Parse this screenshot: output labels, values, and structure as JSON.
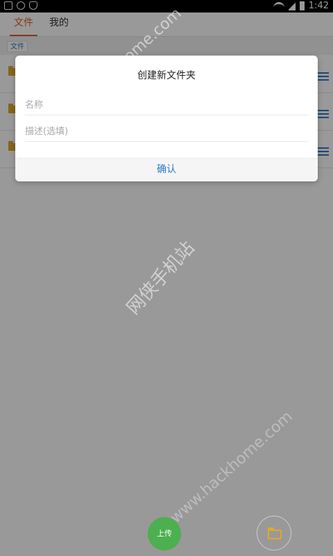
{
  "status_bar": {
    "time": "1:42",
    "icons_left": [
      "image-icon",
      "clock-icon",
      "shield-icon"
    ],
    "icons_right": [
      "wifi-icon",
      "signal-icon",
      "battery-icon"
    ]
  },
  "tabs": [
    {
      "label": "文件",
      "active": true
    },
    {
      "label": "我的",
      "active": false
    }
  ],
  "breadcrumb": {
    "current": "文件"
  },
  "list": {
    "rows": [
      {
        "icon": "folder-icon"
      },
      {
        "icon": "folder-icon"
      },
      {
        "icon": "folder-icon"
      }
    ]
  },
  "dialog": {
    "title": "创建新文件夹",
    "name_placeholder": "名称",
    "name_value": "",
    "desc_placeholder": "描述(选填)",
    "desc_value": "",
    "confirm_label": "确认"
  },
  "bottom": {
    "upload_label": "上传",
    "folder_icon": "folder-icon"
  },
  "watermarks": {
    "top": "www.hackhome.com",
    "middle": "网侠手机站",
    "bottom": "www.hackhome.com"
  },
  "colors": {
    "accent_orange": "#e65a27",
    "link_blue": "#2e7ac7",
    "upload_green": "#4caf50",
    "folder_yellow": "#e0a92a"
  }
}
